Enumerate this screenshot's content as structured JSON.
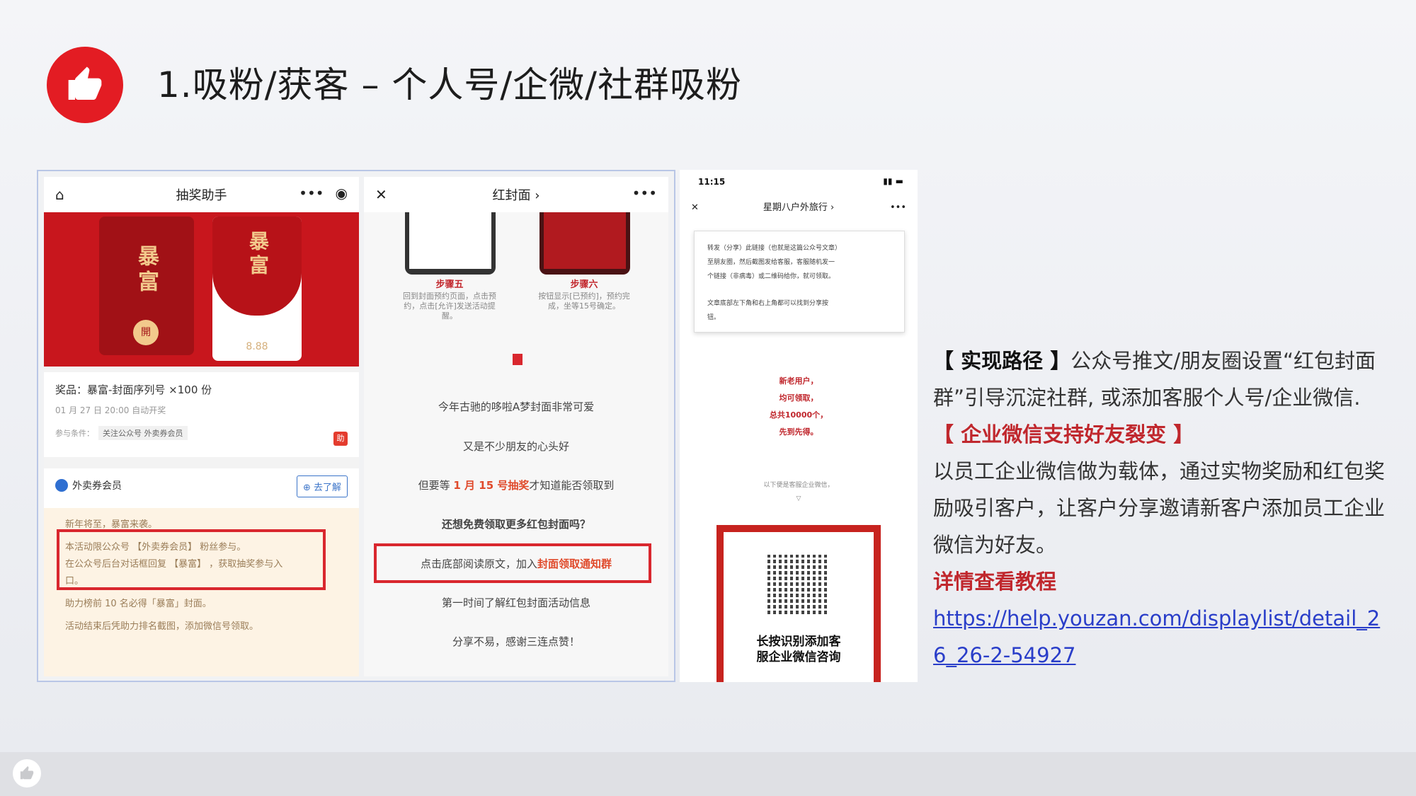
{
  "header": {
    "title": "1.吸粉/获客 – 个人号/企微/社群吸粉"
  },
  "phone1": {
    "nav_title": "抽奖助手",
    "env_a_text": "暴富",
    "env_a_coin": "開",
    "env_b_text": "暴富",
    "env_b_amount": "8.88",
    "prize_line": "奖品：暴富-封面序列号 ×100 份",
    "time_line": "01 月 27 日 20:00 自动开奖",
    "cond_label": "参与条件：",
    "cond_tag": "关注公众号 外卖券会员",
    "zhu": "助",
    "account": "外卖券会员",
    "learn_button": "去了解",
    "body_lines": [
      "新年将至，暴富来袭。",
      "本活动限公众号 【外卖券会员】 粉丝参与。",
      "在公众号后台对话框回复 【暴富】 ，获取抽奖参与入",
      "口。",
      "助力榜前 10 名必得「暴富」封面。",
      "活动结束后凭助力排名截图，添加微信号领取。"
    ]
  },
  "phone2": {
    "nav_title": "红封面 ›",
    "step5_title": "步骤五",
    "step5_desc": "回到封面预约页面，点击预约，点击[允许]发送活动提醒。",
    "step6_title": "步骤六",
    "step6_desc": "按钮显示[已预约]，预约完成，坐等15号确定。",
    "line1": "今年古驰的哆啦A梦封面非常可爱",
    "line2": "又是不少朋友的心头好",
    "line3_pre": "但要等 ",
    "line3_hl": "1 月 15 号抽奖",
    "line3_post": "才知道能否领取到",
    "line4": "还想免费领取更多红包封面吗？",
    "line5_pre": "点击底部阅读原文，加入",
    "line5_hl": "封面领取通知群",
    "line6": "第一时间了解红包封面活动信息",
    "line7": "分享不易，感谢三连点赞！"
  },
  "phone3": {
    "time": "11:15",
    "nav_title": "星期八户外旅行 ›",
    "card_lines": [
      "转发（分享）此链接（也就是这篇公众号文章）",
      "至朋友圈，然后截图发给客服，客服随机发一",
      "个链接（非病毒）或二维码给你，就可领取。",
      "文章底部左下角和右上角都可以找到分享按",
      "钮。"
    ],
    "red_lines": [
      "新老用户，",
      "均可领取，",
      "总共10000个，",
      "先到先得。"
    ],
    "grey_line": "以下便是客服企业微信，",
    "qr_caption_1": "长按识别添加客",
    "qr_caption_2": "服企业微信咨询"
  },
  "right": {
    "p1_bracket": "【 实现路径 】",
    "p1_text": "公众号推文/朋友圈设置“红包封面群”引导沉淀社群, 或添加客服个人号/企业微信.",
    "p2_heading": "【 企业微信支持好友裂变 】",
    "p2_text": "以员工企业微信做为载体，通过实物奖励和红包奖励吸引客户，让客户分享邀请新客户添加员工企业微信为好友。",
    "p3_heading": "详情查看教程",
    "link": "https://help.youzan.com/displaylist/detail_26_26-2-54927"
  },
  "colors": {
    "brand_red": "#e31c23",
    "link_blue": "#2a3ec9"
  }
}
